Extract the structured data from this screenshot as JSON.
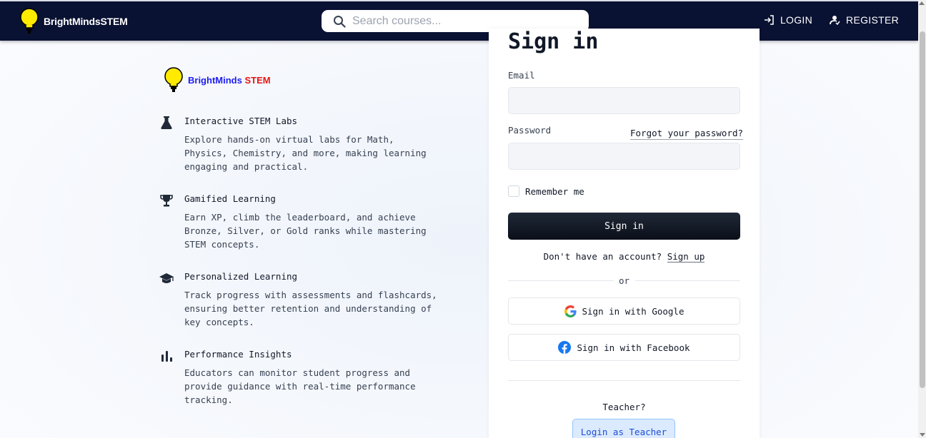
{
  "nav": {
    "brand": "BrightMindsSTEM",
    "search_placeholder": "Search courses...",
    "login_label": "LOGIN",
    "register_label": "REGISTER"
  },
  "left": {
    "brand_part1": "BrightMinds",
    "brand_part2": "STEM",
    "features": [
      {
        "icon": "flask-icon",
        "title": "Interactive STEM Labs",
        "desc": "Explore hands-on virtual labs for Math, Physics, Chemistry, and more, making learning engaging and practical."
      },
      {
        "icon": "trophy-icon",
        "title": "Gamified Learning",
        "desc": "Earn XP, climb the leaderboard, and achieve Bronze, Silver, or Gold ranks while mastering STEM concepts."
      },
      {
        "icon": "graduation-cap-icon",
        "title": "Personalized Learning",
        "desc": "Track progress with assessments and flashcards, ensuring better retention and understanding of key concepts."
      },
      {
        "icon": "bar-chart-icon",
        "title": "Performance Insights",
        "desc": "Educators can monitor student progress and provide guidance with real-time performance tracking."
      }
    ]
  },
  "form": {
    "title": "Sign in",
    "email_label": "Email",
    "email_value": "",
    "password_label": "Password",
    "password_value": "",
    "forgot_label": "Forgot your password?",
    "remember_label": "Remember me",
    "signin_label": "Sign in",
    "no_account_text": "Don't have an account?",
    "signup_label": "Sign up",
    "or_text": "or",
    "google_label": "Sign in with Google",
    "facebook_label": "Sign in with Facebook",
    "teacher_question": "Teacher?",
    "teacher_login_label": "Login as Teacher"
  },
  "colors": {
    "nav_bg": "#0a1233",
    "brand_blue": "#1d1df0",
    "brand_red": "#e81515",
    "bulb_yellow": "#ffea00",
    "teacher_btn_bg": "#dbeafe"
  }
}
